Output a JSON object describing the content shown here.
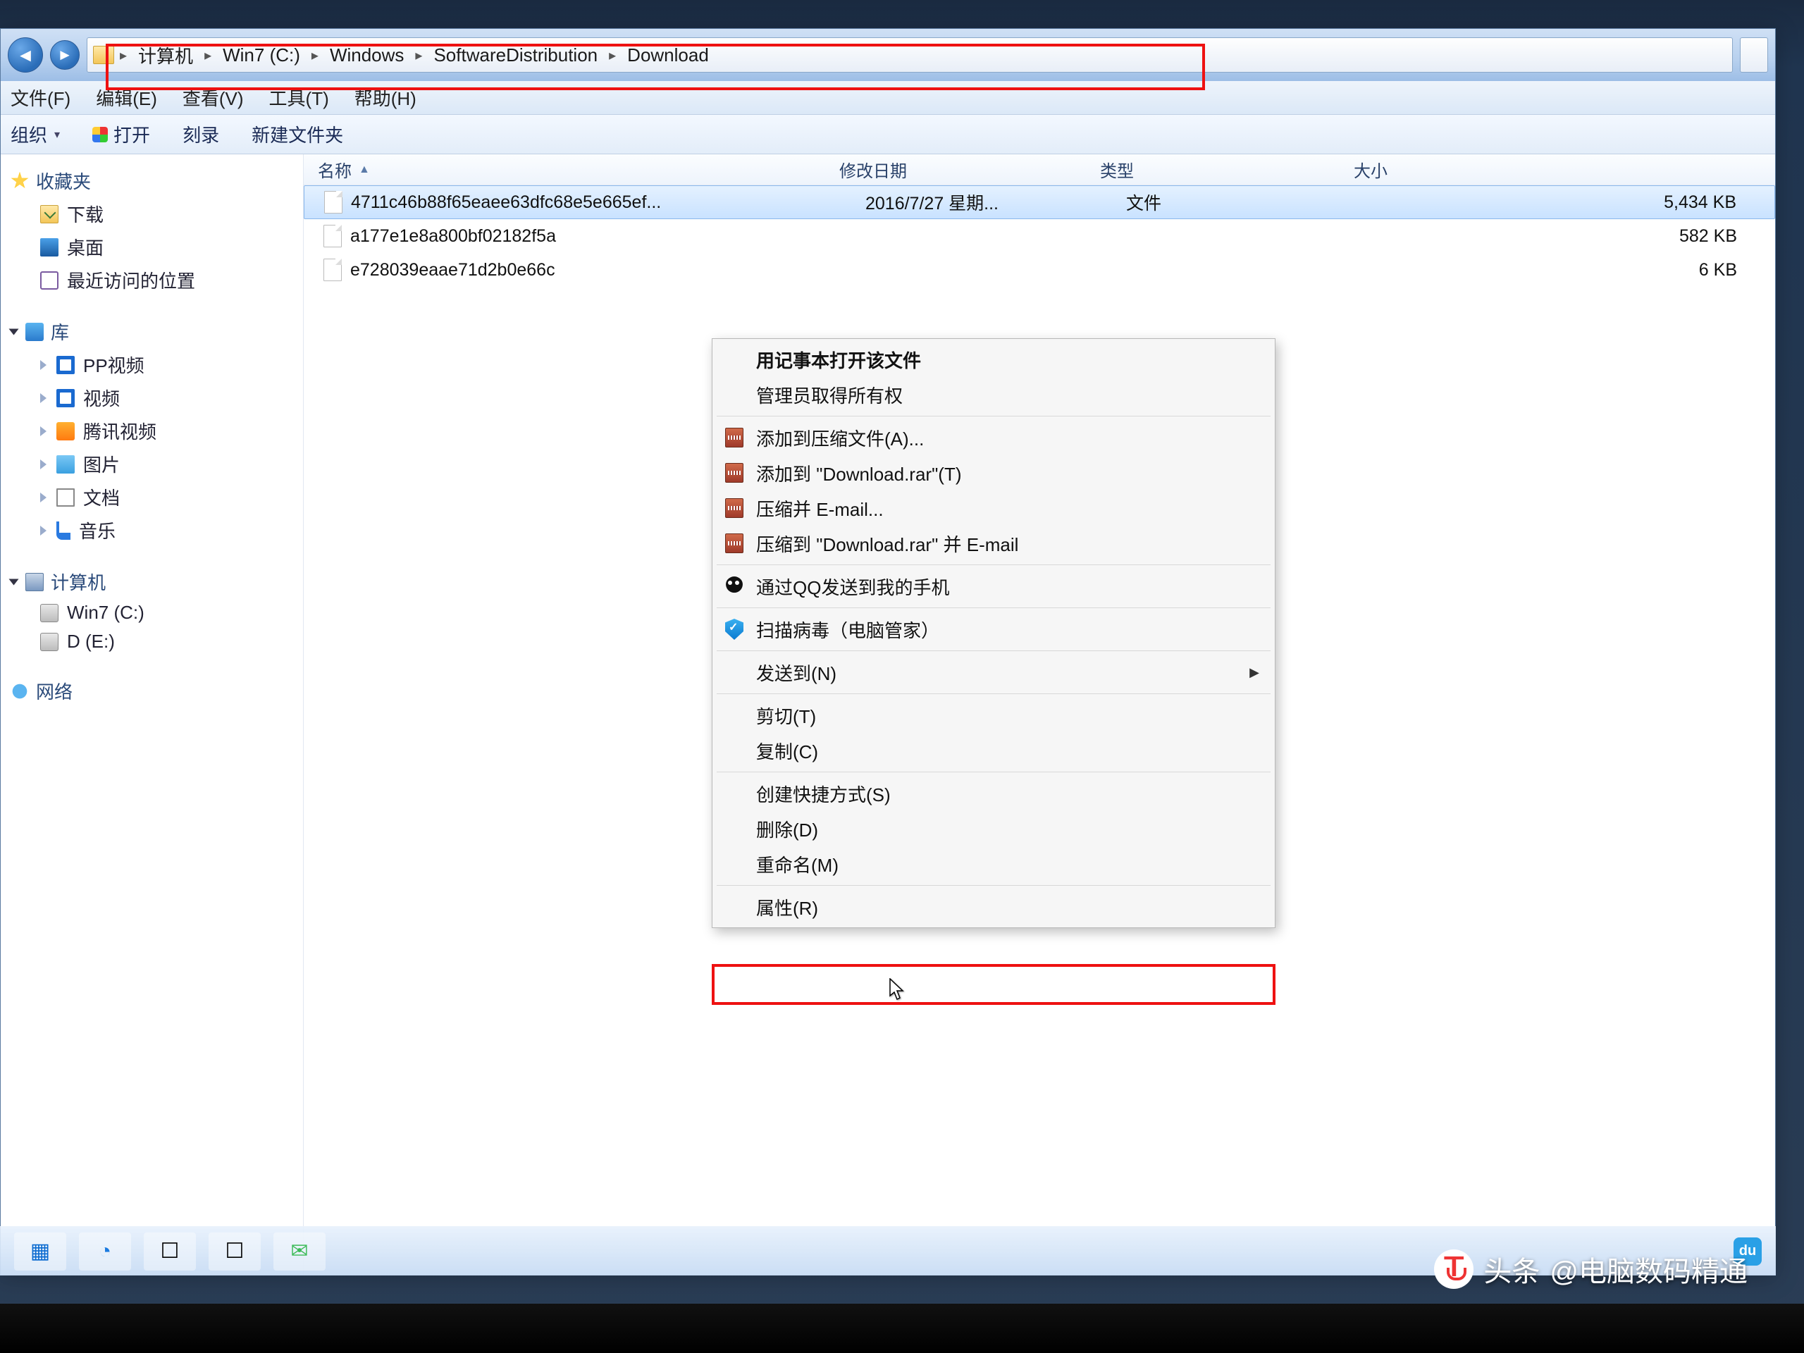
{
  "breadcrumb": {
    "root_icon": "folder-icon",
    "items": [
      "计算机",
      "Win7 (C:)",
      "Windows",
      "SoftwareDistribution",
      "Download"
    ]
  },
  "menubar": {
    "file": "文件(F)",
    "edit": "编辑(E)",
    "view": "查看(V)",
    "tools": "工具(T)",
    "help": "帮助(H)"
  },
  "toolbar": {
    "organize": "组织",
    "open": "打开",
    "burn": "刻录",
    "newfolder": "新建文件夹"
  },
  "sidebar": {
    "favorites": {
      "label": "收藏夹",
      "items": [
        {
          "label": "下载",
          "icon": "download-icon"
        },
        {
          "label": "桌面",
          "icon": "desktop-icon"
        },
        {
          "label": "最近访问的位置",
          "icon": "recent-icon"
        }
      ]
    },
    "libraries": {
      "label": "库",
      "items": [
        {
          "label": "PP视频",
          "icon": "video-icon"
        },
        {
          "label": "视频",
          "icon": "video-icon"
        },
        {
          "label": "腾讯视频",
          "icon": "tx-icon"
        },
        {
          "label": "图片",
          "icon": "pictures-icon"
        },
        {
          "label": "文档",
          "icon": "documents-icon"
        },
        {
          "label": "音乐",
          "icon": "music-icon"
        }
      ]
    },
    "computer": {
      "label": "计算机",
      "items": [
        {
          "label": "Win7 (C:)",
          "icon": "drive-icon"
        },
        {
          "label": "D (E:)",
          "icon": "drive-icon"
        }
      ]
    },
    "network": {
      "label": "网络"
    }
  },
  "columns": {
    "name": "名称",
    "date": "修改日期",
    "type": "类型",
    "size": "大小"
  },
  "files": [
    {
      "name": "4711c46b88f65eaee63dfc68e5e665ef...",
      "date": "2016/7/27 星期...",
      "type": "文件",
      "size": "5,434 KB",
      "selected": true
    },
    {
      "name": "a177e1e8a800bf02182f5a",
      "date": "",
      "type": "",
      "size": "582 KB",
      "selected": false
    },
    {
      "name": "e728039eaae71d2b0e66c",
      "date": "",
      "type": "",
      "size": "6 KB",
      "selected": false
    }
  ],
  "context_menu": {
    "items": [
      {
        "label": "用记事本打开该文件",
        "bold": true
      },
      {
        "label": "管理员取得所有权"
      },
      {
        "sep": true
      },
      {
        "label": "添加到压缩文件(A)...",
        "icon": "rar-icon"
      },
      {
        "label": "添加到 \"Download.rar\"(T)",
        "icon": "rar-icon"
      },
      {
        "label": "压缩并 E-mail...",
        "icon": "rar-icon"
      },
      {
        "label": "压缩到 \"Download.rar\" 并 E-mail",
        "icon": "rar-icon"
      },
      {
        "sep": true
      },
      {
        "label": "通过QQ发送到我的手机",
        "icon": "qq-icon"
      },
      {
        "sep": true
      },
      {
        "label": "扫描病毒（电脑管家）",
        "icon": "shield-icon"
      },
      {
        "sep": true
      },
      {
        "label": "发送到(N)",
        "submenu": true
      },
      {
        "sep": true
      },
      {
        "label": "剪切(T)"
      },
      {
        "label": "复制(C)"
      },
      {
        "sep": true
      },
      {
        "label": "创建快捷方式(S)"
      },
      {
        "label": "删除(D)",
        "highlight": true
      },
      {
        "label": "重命名(M)"
      },
      {
        "sep": true
      },
      {
        "label": "属性(R)"
      }
    ]
  },
  "taskbar": {
    "items": [
      "film-icon",
      "round-icon",
      "app-icon",
      "app-icon",
      "wechat-icon"
    ],
    "du": "du"
  },
  "watermark": {
    "prefix": "头条",
    "handle": "@电脑数码精通"
  }
}
